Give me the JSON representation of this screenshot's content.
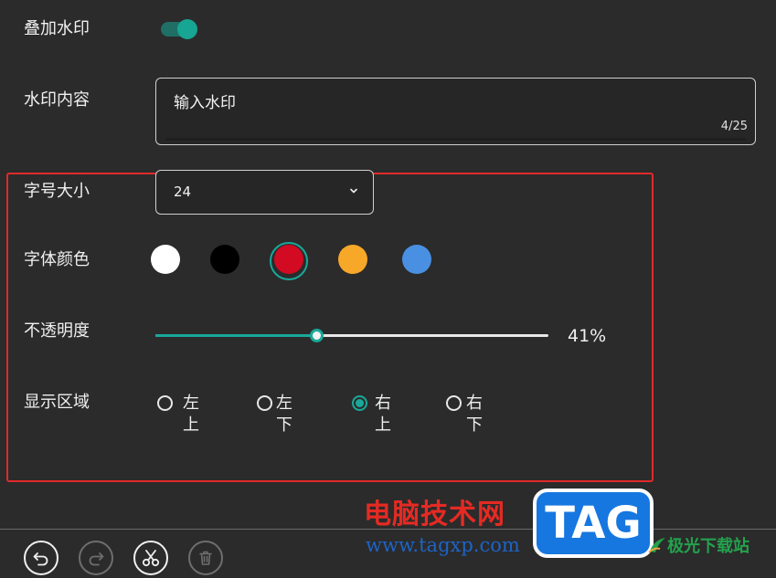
{
  "overlay_watermark": {
    "label": "叠加水印",
    "enabled": true
  },
  "watermark_content": {
    "label": "水印内容",
    "value": "输入水印",
    "counter": "4/25"
  },
  "font_size": {
    "label": "字号大小",
    "value": "24"
  },
  "font_color": {
    "label": "字体颜色",
    "options": [
      "#ffffff",
      "#000000",
      "#d20a22",
      "#f7a828",
      "#4a90e2"
    ],
    "selected_index": 2
  },
  "opacity": {
    "label": "不透明度",
    "value_text": "41%",
    "value": 41,
    "accent": "#19a99a"
  },
  "display_area": {
    "label": "显示区域",
    "options": [
      {
        "label": "左上",
        "checked": false
      },
      {
        "label": "左下",
        "checked": false
      },
      {
        "label": "右上",
        "checked": true
      },
      {
        "label": "右下",
        "checked": false
      }
    ]
  },
  "toolbar": {
    "buttons": [
      {
        "icon": "undo-icon",
        "enabled": true
      },
      {
        "icon": "redo-icon",
        "enabled": false
      },
      {
        "icon": "scissors-icon",
        "enabled": true
      },
      {
        "icon": "trash-icon",
        "enabled": false
      }
    ]
  },
  "site_watermark": {
    "brand_text": "电脑技术网",
    "url_text": "www.tagxp.com",
    "logo_text": "TAG",
    "site_text": "极光下载站"
  }
}
